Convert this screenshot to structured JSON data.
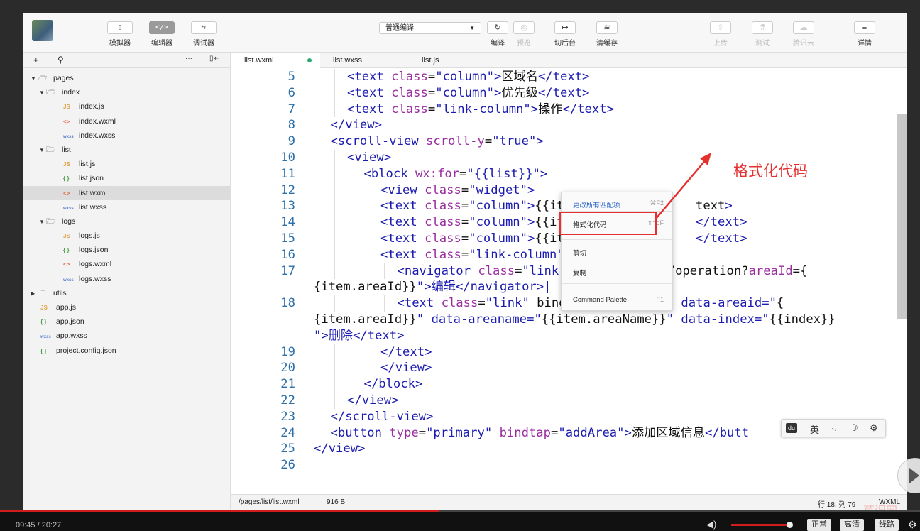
{
  "toolbar": {
    "simulator": "模拟器",
    "editor": "编辑器",
    "debugger": "调试器",
    "compile_mode": "普通编译",
    "compile": "编译",
    "preview": "预览",
    "background": "切后台",
    "clear_cache": "清缓存",
    "upload": "上传",
    "test": "测试",
    "cloud": "腾讯云",
    "details": "详情",
    "simulator_icon": "phone-icon",
    "editor_icon": "code-icon",
    "debugger_icon": "debug-icon"
  },
  "sidebar": {
    "items": [
      {
        "label": "pages",
        "type": "folder",
        "indent": 0,
        "expanded": true
      },
      {
        "label": "index",
        "type": "folder",
        "indent": 1,
        "expanded": true
      },
      {
        "label": "index.js",
        "type": "js",
        "indent": 2
      },
      {
        "label": "index.wxml",
        "type": "wxml",
        "indent": 2
      },
      {
        "label": "index.wxss",
        "type": "wxss",
        "indent": 2
      },
      {
        "label": "list",
        "type": "folder",
        "indent": 1,
        "expanded": true
      },
      {
        "label": "list.js",
        "type": "js",
        "indent": 2
      },
      {
        "label": "list.json",
        "type": "json",
        "indent": 2
      },
      {
        "label": "list.wxml",
        "type": "wxml",
        "indent": 2,
        "selected": true
      },
      {
        "label": "list.wxss",
        "type": "wxss",
        "indent": 2
      },
      {
        "label": "logs",
        "type": "folder",
        "indent": 1,
        "expanded": true
      },
      {
        "label": "logs.js",
        "type": "js",
        "indent": 2
      },
      {
        "label": "logs.json",
        "type": "json",
        "indent": 2
      },
      {
        "label": "logs.wxml",
        "type": "wxml",
        "indent": 2
      },
      {
        "label": "logs.wxss",
        "type": "wxss",
        "indent": 2
      },
      {
        "label": "utils",
        "type": "folder",
        "indent": 0,
        "expanded": false
      },
      {
        "label": "app.js",
        "type": "js",
        "indent": 0
      },
      {
        "label": "app.json",
        "type": "json",
        "indent": 0
      },
      {
        "label": "app.wxss",
        "type": "wxss",
        "indent": 0
      },
      {
        "label": "project.config.json",
        "type": "json",
        "indent": 0
      }
    ]
  },
  "tabs": [
    {
      "label": "list.wxml",
      "active": true,
      "modified": true
    },
    {
      "label": "list.wxss"
    },
    {
      "label": "list.js"
    }
  ],
  "code": [
    {
      "n": "5",
      "indent": 2,
      "text": "<text class=\"column\">区域名</text>"
    },
    {
      "n": "6",
      "indent": 2,
      "text": "<text class=\"column\">优先级</text>"
    },
    {
      "n": "7",
      "indent": 2,
      "text": "<text class=\"link-column\">操作</text>"
    },
    {
      "n": "8",
      "indent": 1,
      "text": "</view>"
    },
    {
      "n": "9",
      "indent": 1,
      "text": "<scroll-view scroll-y=\"true\">"
    },
    {
      "n": "10",
      "indent": 2,
      "text": "<view>"
    },
    {
      "n": "11",
      "indent": 3,
      "text": "<block wx:for=\"{{list}}\">"
    },
    {
      "n": "12",
      "indent": 4,
      "text": "<view class=\"widget\">"
    },
    {
      "n": "13",
      "indent": 4,
      "text": "<text class=\"column\">{{it"
    },
    {
      "n": "14",
      "indent": 4,
      "text": "<text class=\"column\">{{it"
    },
    {
      "n": "15",
      "indent": 4,
      "text": "<text class=\"column\">{{it"
    },
    {
      "n": "16",
      "indent": 4,
      "text": "<text class=\"link-column\""
    },
    {
      "n": "17",
      "indent": 5,
      "text": "<navigator class=\"link\""
    },
    {
      "n": "",
      "indent": 0,
      "text": "{item.areaId}}\">编辑</navigator>|"
    },
    {
      "n": "18",
      "indent": 5,
      "text": "<text class=\"link\" bind"
    },
    {
      "n": "",
      "indent": 0,
      "text": "{item.areaId}}\" data-areaname=\"{{item.areaName}}\" data-index=\"{{index}}"
    },
    {
      "n": "",
      "indent": 0,
      "text": "\">删除</text>"
    },
    {
      "n": "19",
      "indent": 4,
      "text": "</text>"
    },
    {
      "n": "20",
      "indent": 4,
      "text": "</view>"
    },
    {
      "n": "21",
      "indent": 3,
      "text": "</block>"
    },
    {
      "n": "22",
      "indent": 2,
      "text": "</view>"
    },
    {
      "n": "23",
      "indent": 1,
      "text": "</scroll-view>"
    },
    {
      "n": "24",
      "indent": 1,
      "text": "<button type=\"primary\" bindtap=\"addArea\">添加区域信息</butt"
    },
    {
      "n": "25",
      "indent": 0,
      "text": "</view>"
    },
    {
      "n": "26",
      "indent": 0,
      "text": ""
    }
  ],
  "code_tails": [
    {
      "line": 8,
      "text": "text>"
    },
    {
      "line": 9,
      "text": "</text>"
    },
    {
      "line": 10,
      "text": "</text>"
    },
    {
      "line": 12,
      "text": "ation/operation?areaId={"
    },
    {
      "line": 14,
      "text": "ea\" data-areaid=\"{"
    }
  ],
  "context_menu": {
    "items": [
      {
        "label": "更改所有匹配项",
        "key": "⌘F2",
        "blue": true
      },
      {
        "label": "格式化代码",
        "key": "⇧⌥F"
      },
      {
        "label": "剪切",
        "key": ""
      },
      {
        "label": "复制",
        "key": ""
      },
      {
        "label": "Command Palette",
        "key": "F1"
      }
    ]
  },
  "annotation": "格式化代码",
  "ime": {
    "mode": "英",
    "logo": "du"
  },
  "status": {
    "path": "/pages/list/list.wxml",
    "size": "916 B",
    "position": "行 18, 列 79",
    "lang": "WXML"
  },
  "watermark": "慕课网",
  "video": {
    "time": "09:45 / 20:27",
    "progress": 0.477,
    "btn_normal": "正常",
    "btn_hd": "高清",
    "btn_route": "线路"
  },
  "colors": {
    "annotation": "#e53030",
    "progress": "#d01c1c",
    "tag": "#1c1cb0",
    "attr": "#9a2ea0",
    "line_number": "#2c6fa8"
  }
}
